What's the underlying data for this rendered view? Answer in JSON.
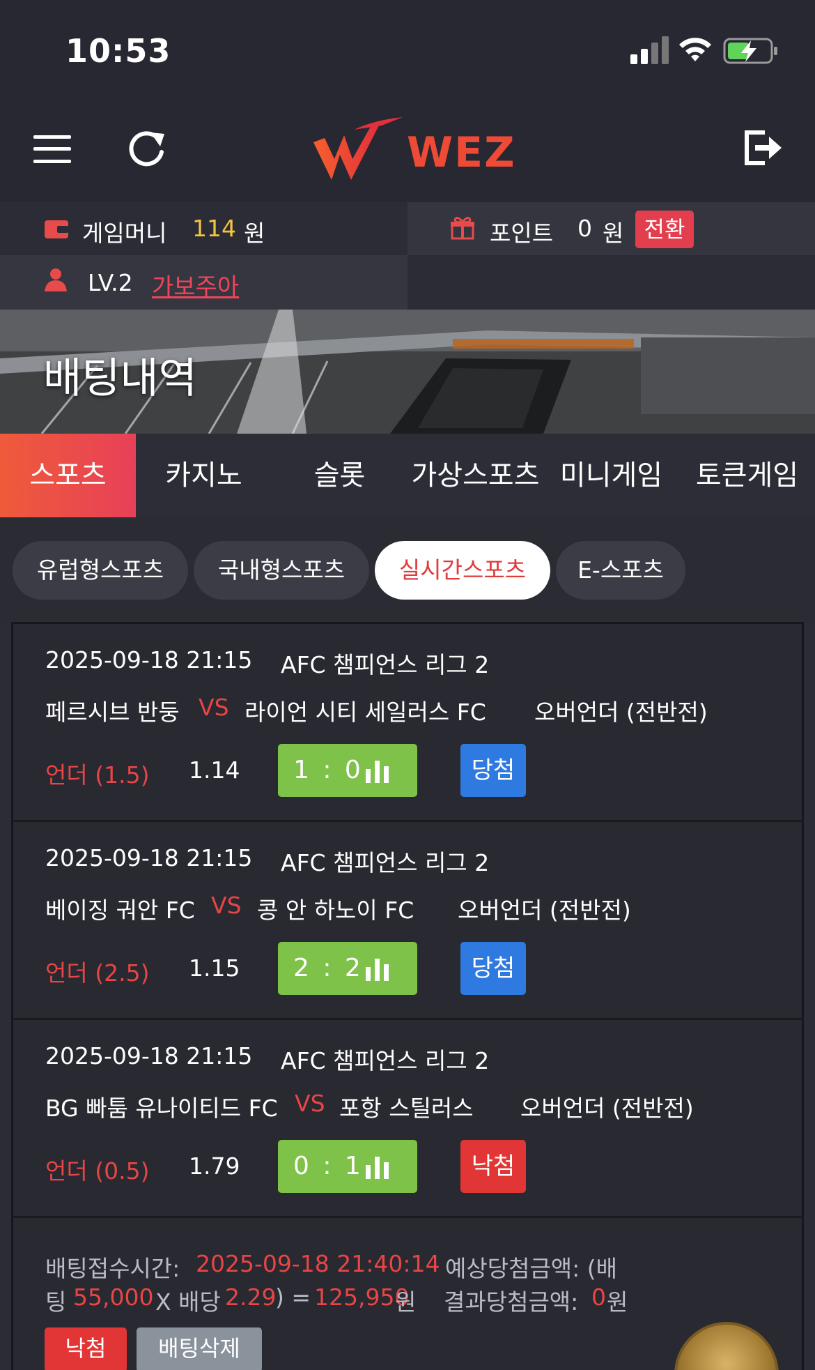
{
  "status": {
    "time": "10:53"
  },
  "header": {
    "logo_text": "WEZ"
  },
  "account": {
    "money_label": "게임머니",
    "money_value": "114",
    "money_unit": "원",
    "point_label": "포인트",
    "point_value": "0",
    "point_unit": "원",
    "convert_label": "전환",
    "level": "LV.2",
    "rank_name": "가보주아"
  },
  "banner": {
    "title": "배팅내역"
  },
  "tabs": [
    {
      "label": "스포츠",
      "active": true
    },
    {
      "label": "카지노"
    },
    {
      "label": "슬롯"
    },
    {
      "label": "가상스포츠"
    },
    {
      "label": "미니게임"
    },
    {
      "label": "토큰게임"
    }
  ],
  "subtabs": [
    {
      "label": "유럽형스포츠"
    },
    {
      "label": "국내형스포츠"
    },
    {
      "label": "실시간스포츠",
      "active": true
    },
    {
      "label": "E-스포츠"
    }
  ],
  "bets": [
    {
      "datetime": "2025-09-18 21:15",
      "league": "AFC 챔피언스 리그 2",
      "home": "페르시브 반둥",
      "vs": "VS",
      "away": "라이언 시티 세일러스 FC",
      "market": "오버언더 (전반전)",
      "pick": "언더 (1.5)",
      "odds": "1.14",
      "score": "1 : 0",
      "result": "당첨"
    },
    {
      "datetime": "2025-09-18 21:15",
      "league": "AFC 챔피언스 리그 2",
      "home": "베이징 궈안 FC",
      "vs": "VS",
      "away": "콩 안 하노이 FC",
      "market": "오버언더 (전반전)",
      "pick": "언더 (2.5)",
      "odds": "1.15",
      "score": "2 : 2",
      "result": "당첨"
    },
    {
      "datetime": "2025-09-18 21:15",
      "league": "AFC 챔피언스 리그 2",
      "home": "BG 빠툼 유나이티드 FC",
      "vs": "VS",
      "away": "포항 스틸러스",
      "market": "오버언더 (전반전)",
      "pick": "언더 (0.5)",
      "odds": "1.79",
      "score": "0 : 1",
      "result": "낙첨"
    }
  ],
  "summary": {
    "time_label": "배팅접수시간:",
    "time_value": "2025-09-18 21:40:14",
    "expected_label": "예상당첨금액: (배",
    "bet_prefix": "팅",
    "bet_amount": "55,000",
    "x_label": "X 배당",
    "odds_total": "2.29",
    "eq": ") =",
    "expected_value": "125,950",
    "won": "원",
    "result_label": "결과당첨금액:",
    "result_value": "0",
    "result_unit": "원",
    "lose_button": "낙첨",
    "delete_button": "배팅삭제"
  }
}
